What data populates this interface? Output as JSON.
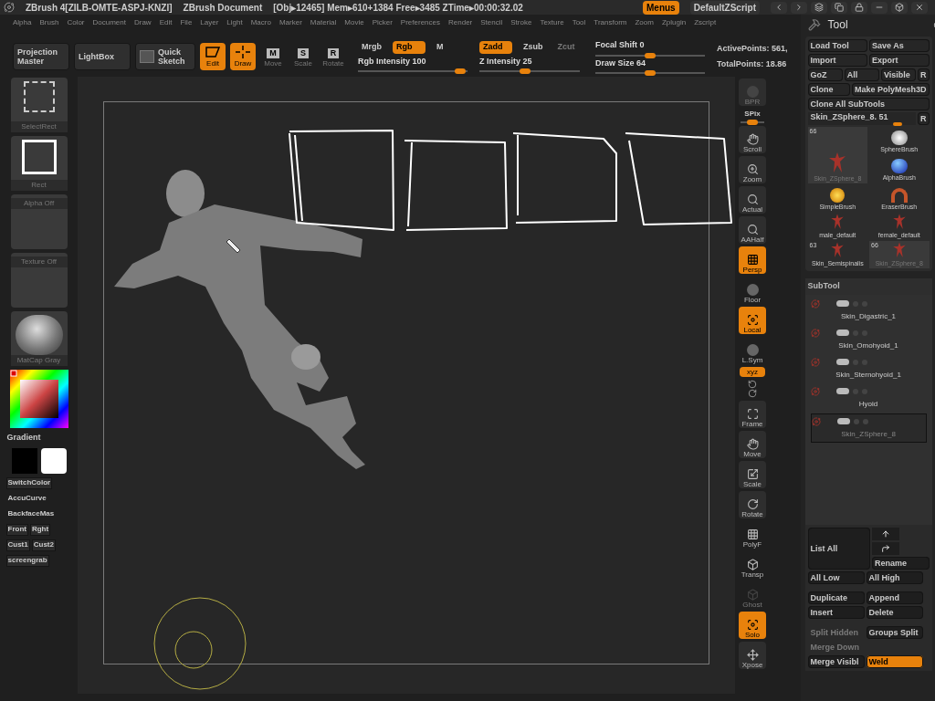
{
  "title_bar": {
    "app": "ZBrush 4[ZILB-OMTE-ASPJ-KNZI]",
    "document": "ZBrush Document",
    "stats": "[Obj▸12465] Mem▸610+1384 Free▸3485 ZTime▸00:00:32.02",
    "buttons": [
      {
        "label": "Menus",
        "selected": true
      },
      {
        "label": "DefaultZScript",
        "selected": false
      }
    ]
  },
  "menu_bar": [
    "Alpha",
    "Brush",
    "Color",
    "Document",
    "Draw",
    "Edit",
    "File",
    "Layer",
    "Light",
    "Macro",
    "Marker",
    "Material",
    "Movie",
    "Picker",
    "Preferences",
    "Render",
    "Stencil",
    "Stroke",
    "Texture",
    "Tool",
    "Transform",
    "Zoom",
    "Zplugin",
    "Zscript"
  ],
  "top_shelf": {
    "buttons": [
      {
        "label": "Projection Master",
        "kind": "text"
      },
      {
        "label": "LightBox",
        "kind": "text"
      },
      {
        "label": "Quick Sketch",
        "kind": "sketch"
      }
    ],
    "modes": [
      {
        "label": "Edit",
        "kind": "edit",
        "selected": true
      },
      {
        "label": "Draw",
        "kind": "draw",
        "selected": true
      },
      {
        "label": "Move",
        "key": "M",
        "kind": "key",
        "selected": false
      },
      {
        "label": "Scale",
        "key": "S",
        "kind": "key",
        "selected": false
      },
      {
        "label": "Rotate",
        "key": "R",
        "kind": "key",
        "selected": false
      }
    ],
    "color_modes": [
      {
        "label": "Mrgb",
        "selected": false,
        "disabled": false
      },
      {
        "label": "Rgb",
        "selected": true,
        "disabled": false
      },
      {
        "label": "M",
        "selected": false,
        "disabled": false
      }
    ],
    "depth_modes": [
      {
        "label": "Zadd",
        "selected": true,
        "disabled": false
      },
      {
        "label": "Zsub",
        "selected": false,
        "disabled": false
      },
      {
        "label": "Zcut",
        "selected": false,
        "disabled": true
      }
    ],
    "sliders": [
      {
        "label": "Rgb Intensity",
        "value": "100",
        "level": 0.93
      },
      {
        "label": "Z Intensity",
        "value": "25",
        "level": 0.45
      },
      {
        "label": "Focal Shift",
        "value": "0",
        "level": 0.5
      },
      {
        "label": "Draw Size",
        "value": "64",
        "level": 0.5
      }
    ],
    "stats": [
      "ActivePoints: 561,",
      "TotalPoints: 18.86"
    ]
  },
  "left_shelf": {
    "tiles": [
      {
        "label": "SelectRect",
        "kind": "select"
      },
      {
        "label": "Rect",
        "kind": "rect"
      },
      {
        "label": "Alpha Off",
        "kind": "empty"
      },
      {
        "label": "Texture Off",
        "kind": "empty"
      },
      {
        "label": "MatCap Gray",
        "kind": "sphere"
      }
    ],
    "gradient": "Gradient",
    "buttons": [
      [
        {
          "label": "SwitchColor",
          "kind": "button"
        }
      ],
      [
        {
          "label": "AccuCurve",
          "kind": "toggle"
        }
      ],
      [
        {
          "label": "BackfaceMas",
          "kind": "toggle"
        }
      ],
      [
        {
          "label": "Front",
          "kind": "button"
        },
        {
          "label": "Rght",
          "kind": "button"
        }
      ],
      [
        {
          "label": "Cust1",
          "kind": "button"
        },
        {
          "label": "Cust2",
          "kind": "button"
        }
      ],
      [
        {
          "label": "screengrab",
          "kind": "button"
        }
      ]
    ]
  },
  "right_shelf": [
    {
      "label": "BPR",
      "kind": "tile",
      "selected": false,
      "disabled": true
    },
    {
      "label": "SPix",
      "kind": "slider",
      "level": 0.5
    },
    {
      "label": "Scroll",
      "kind": "tile",
      "selected": false,
      "disabled": false
    },
    {
      "label": "Zoom",
      "kind": "tile",
      "selected": false,
      "disabled": false
    },
    {
      "label": "Actual",
      "kind": "tile",
      "selected": false,
      "disabled": false
    },
    {
      "label": "AAHalf",
      "kind": "tile",
      "selected": false,
      "disabled": false
    },
    {
      "label": "Persp",
      "kind": "tile",
      "selected": true,
      "disabled": false
    },
    {
      "label": "Floor",
      "kind": "plain",
      "selected": false,
      "disabled": false
    },
    {
      "label": "Local",
      "kind": "tile",
      "selected": true,
      "disabled": false
    },
    {
      "label": "L.Sym",
      "kind": "plain",
      "selected": false,
      "disabled": false
    },
    {
      "label": "xyz",
      "kind": "small",
      "selected": true,
      "disabled": false
    },
    {
      "kind": "icons"
    },
    {
      "label": "Frame",
      "kind": "tile",
      "selected": false,
      "disabled": false
    },
    {
      "label": "Move",
      "kind": "tile",
      "selected": false,
      "disabled": false
    },
    {
      "label": "Scale",
      "kind": "tile",
      "selected": false,
      "disabled": false
    },
    {
      "label": "Rotate",
      "kind": "tile",
      "selected": false,
      "disabled": false
    },
    {
      "label": "PolyF",
      "kind": "plain",
      "selected": false,
      "disabled": false
    },
    {
      "label": "Transp",
      "kind": "plain",
      "selected": false,
      "disabled": false
    },
    {
      "label": "Ghost",
      "kind": "plain",
      "selected": false,
      "disabled": true
    },
    {
      "label": "Solo",
      "kind": "tile",
      "selected": true,
      "disabled": false
    },
    {
      "label": "Xpose",
      "kind": "tile",
      "selected": false,
      "disabled": false
    }
  ],
  "tool_panel": {
    "title": "Tool",
    "button_rows": [
      [
        {
          "label": "Load Tool"
        },
        {
          "label": "Save As"
        }
      ],
      [
        {
          "label": "Import"
        },
        {
          "label": "Export"
        }
      ],
      [
        {
          "label": "GoZ"
        },
        {
          "label": "All"
        },
        {
          "label": "Visible"
        },
        {
          "label": "R"
        }
      ],
      [
        {
          "label": "Clone"
        },
        {
          "label": "Make PolyMesh3D"
        }
      ],
      [
        {
          "label": "Clone All SubTools"
        }
      ]
    ],
    "tool_slider": {
      "label": "Skin_ZSphere_8. 51",
      "level": 0.85,
      "button": "R"
    },
    "tools": [
      {
        "name": "Skin_ZSphere_8",
        "count": "66",
        "kind": "current",
        "selected": true
      },
      {
        "name": "SphereBrush",
        "kind": "sphere",
        "selected": false
      },
      {
        "name": "AlphaBrush",
        "kind": "alpha",
        "selected": false
      },
      {
        "name": "SimpleBrush",
        "kind": "simple",
        "selected": false
      },
      {
        "name": "EraserBrush",
        "kind": "eraser",
        "selected": false
      },
      {
        "name": "male_default",
        "kind": "figure",
        "selected": false
      },
      {
        "name": "female_default",
        "kind": "figure",
        "selected": false
      },
      {
        "name": "Skin_Semispinalis",
        "count": "63",
        "kind": "figure",
        "selected": false
      },
      {
        "name": "Skin_ZSphere_8",
        "count": "66",
        "kind": "figure",
        "selected": true
      }
    ]
  },
  "subtool": {
    "title": "SubTool",
    "items": [
      {
        "name": "Skin_Digastric_1",
        "selected": false
      },
      {
        "name": "Skin_Omohyoid_1",
        "selected": false
      },
      {
        "name": "Skin_Sternohyoid_1",
        "selected": false
      },
      {
        "name": "Hyoid",
        "selected": false
      },
      {
        "name": "Skin_ZSphere_8",
        "selected": true
      }
    ],
    "list_all": "List All",
    "rename": "Rename",
    "button_rows": [
      [
        {
          "label": "All Low",
          "disabled": false,
          "selected": false
        },
        {
          "label": "All High",
          "disabled": false,
          "selected": false
        }
      ],
      [
        {
          "label": "Duplicate",
          "disabled": false,
          "selected": false
        },
        {
          "label": "Append",
          "disabled": false,
          "selected": false
        }
      ],
      [
        {
          "label": "Insert",
          "disabled": false,
          "selected": false
        },
        {
          "label": "Delete",
          "disabled": false,
          "selected": false
        }
      ],
      [
        {
          "label": "Split Hidden",
          "disabled": true,
          "selected": false
        },
        {
          "label": "Groups Split",
          "disabled": false,
          "selected": false
        }
      ],
      [
        {
          "label": "Merge Down",
          "disabled": true,
          "selected": false
        }
      ],
      [
        {
          "label": "Merge Visibl",
          "disabled": false,
          "selected": false
        },
        {
          "label": "Weld",
          "disabled": false,
          "selected": true
        }
      ]
    ]
  }
}
